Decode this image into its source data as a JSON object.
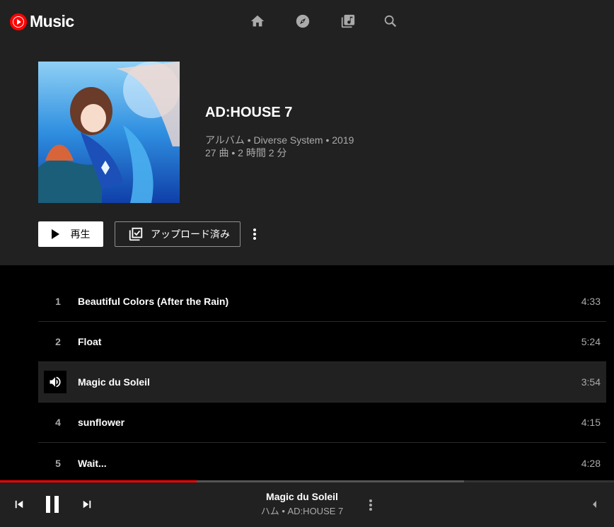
{
  "app": {
    "name": "Music"
  },
  "album": {
    "title": "AD:HOUSE 7",
    "meta_line1": "アルバム • Diverse System • 2019",
    "meta_line2": "27 曲 • 2 時間 2 分"
  },
  "actions": {
    "play_label": "再生",
    "upload_label": "アップロード済み"
  },
  "tracks": [
    {
      "num": "1",
      "title": "Beautiful Colors (After the Rain)",
      "duration": "4:33"
    },
    {
      "num": "2",
      "title": "Float",
      "duration": "5:24"
    },
    {
      "num": "",
      "title": "Magic du Soleil",
      "duration": "3:54"
    },
    {
      "num": "4",
      "title": "sunflower",
      "duration": "4:15"
    },
    {
      "num": "5",
      "title": "Wait...",
      "duration": "4:28"
    }
  ],
  "now_playing": {
    "title": "Magic du Soleil",
    "subtitle": "ハム • AD:HOUSE 7",
    "progress_fraction": 0.32
  },
  "colors": {
    "accent": "#ff0000",
    "background": "#212121"
  }
}
